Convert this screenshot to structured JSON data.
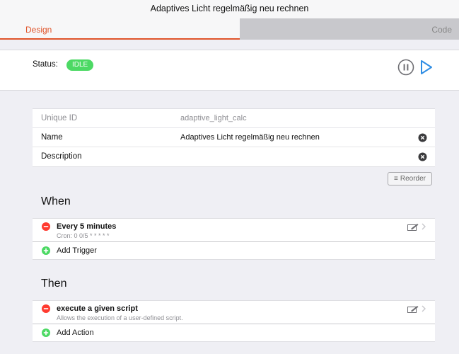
{
  "window": {
    "title": "Adaptives Licht regelmäßig neu rechnen"
  },
  "tabs": [
    {
      "label": "Design",
      "active": true
    },
    {
      "label": "Code",
      "active": false
    }
  ],
  "status": {
    "label": "Status:",
    "badge": "IDLE",
    "badge_color": "#4cd964"
  },
  "properties": {
    "unique_id": {
      "label": "Unique ID",
      "value": "adaptive_light_calc"
    },
    "name": {
      "label": "Name",
      "value": "Adaptives Licht regelmäßig neu rechnen"
    },
    "description": {
      "label": "Description",
      "value": ""
    }
  },
  "reorder": {
    "label": "Reorder"
  },
  "when": {
    "heading": "When",
    "items": [
      {
        "title": "Every 5 minutes",
        "subtitle": "Cron: 0 0/5 * * * * *"
      }
    ],
    "add_label": "Add Trigger"
  },
  "then": {
    "heading": "Then",
    "items": [
      {
        "title": "execute a given script",
        "subtitle": "Allows the execution of a user-defined script."
      }
    ],
    "add_label": "Add Action"
  },
  "colors": {
    "accent": "#e0542a",
    "play": "#2f8de4",
    "remove": "#ff3b30",
    "add": "#4cd964"
  }
}
